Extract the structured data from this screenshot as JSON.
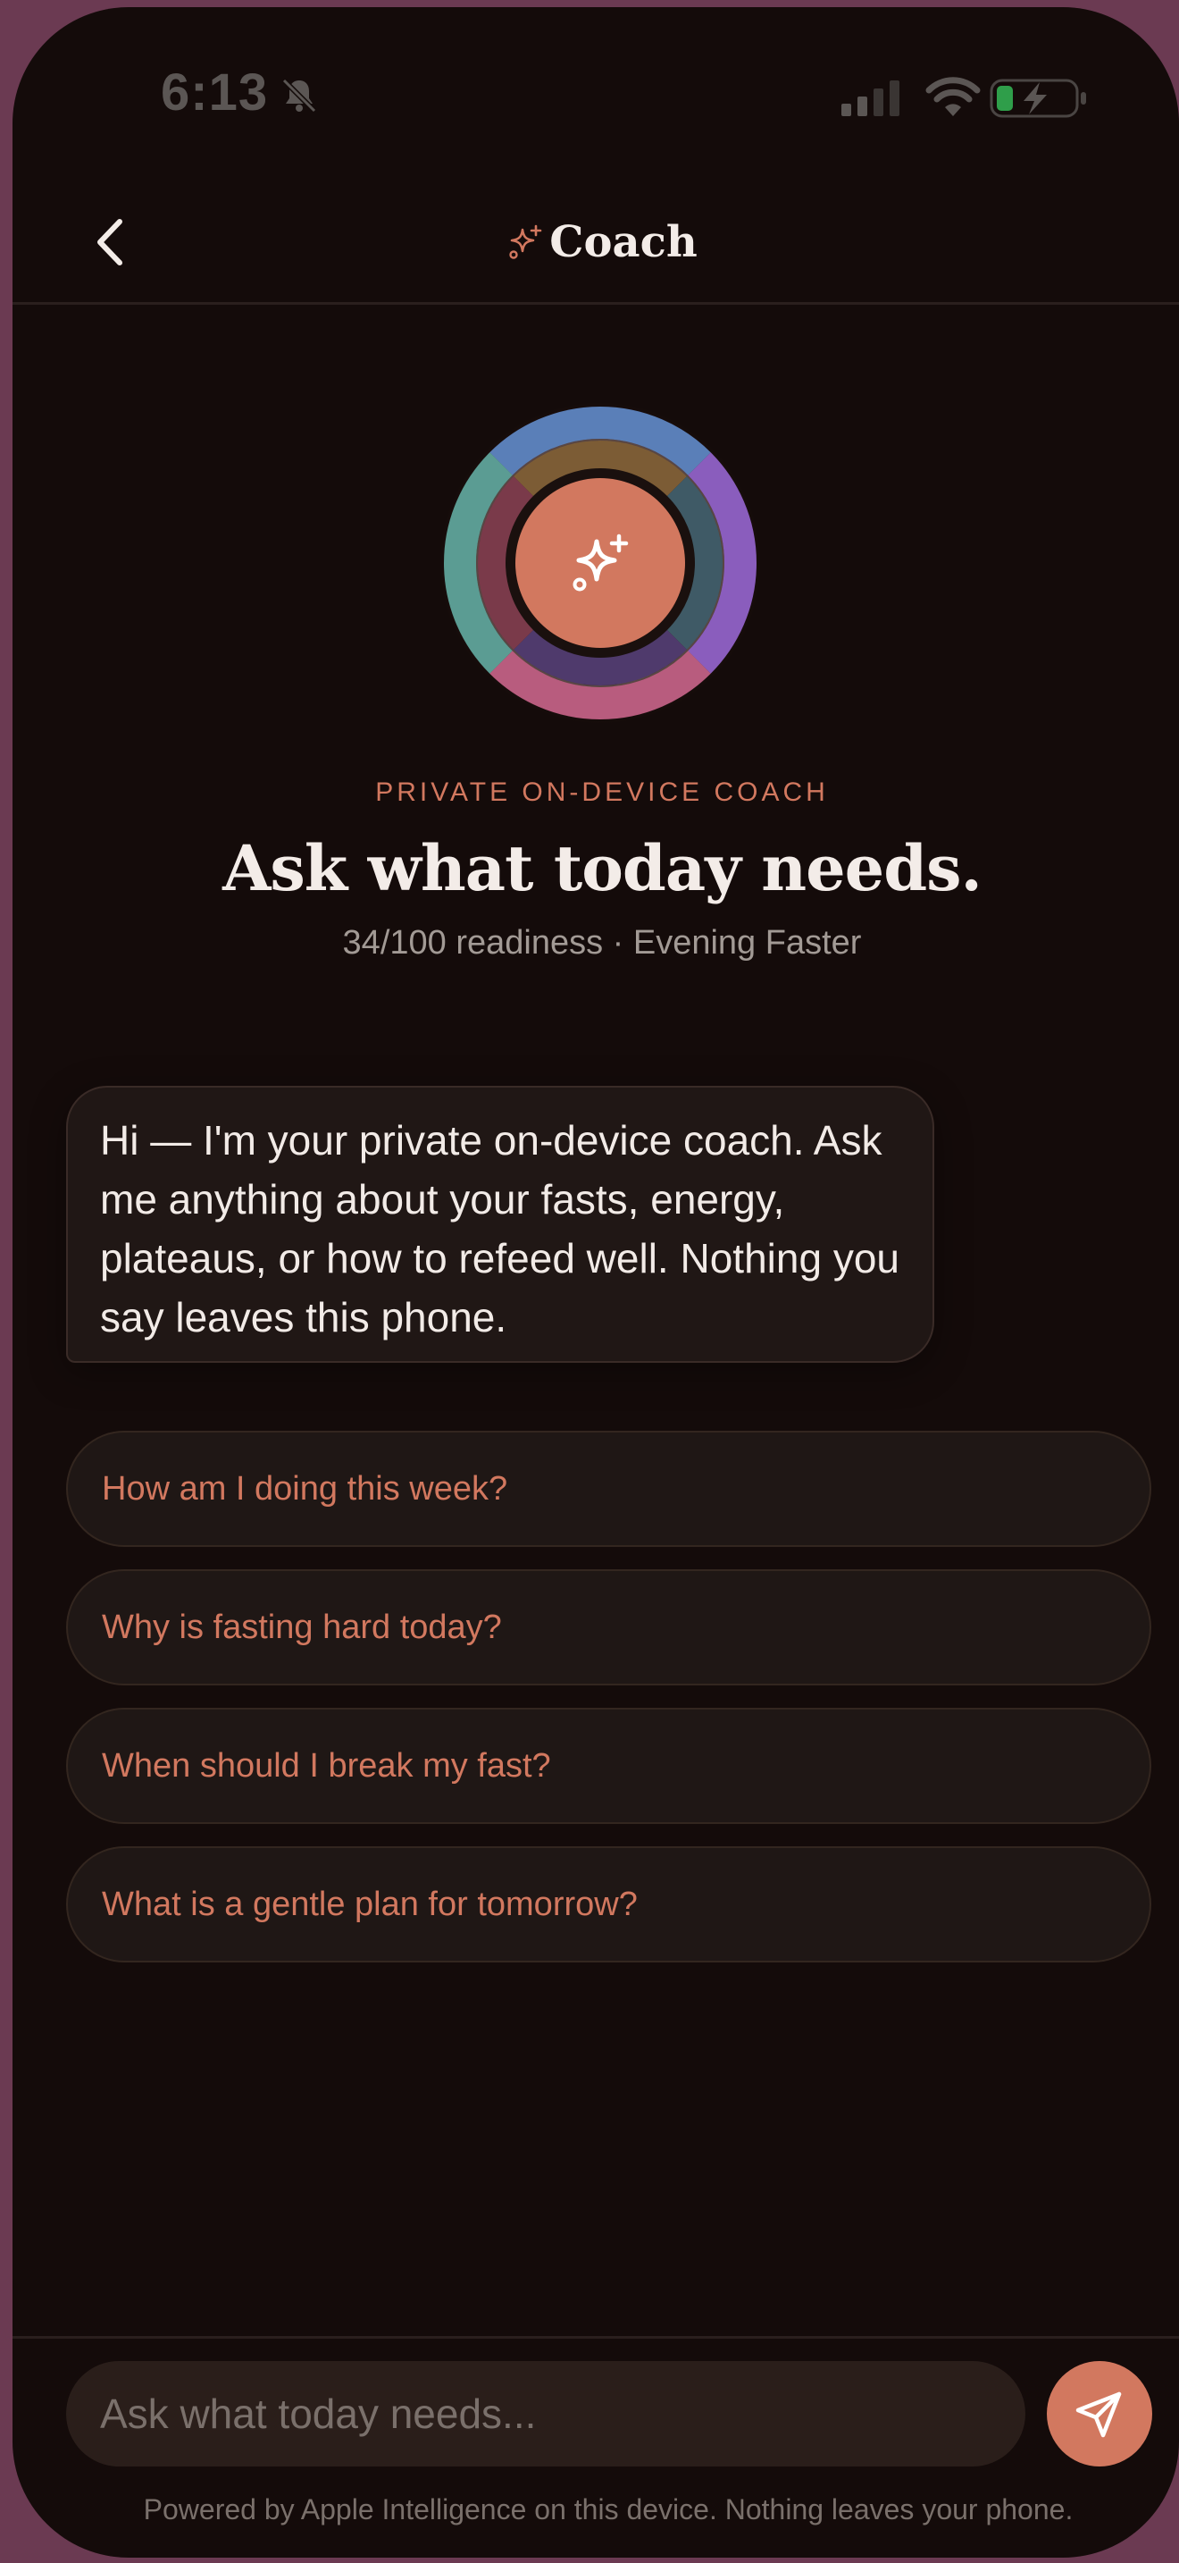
{
  "status_bar": {
    "time": "6:13",
    "icons": [
      "bell-muted-icon",
      "cellular-signal-icon",
      "wifi-icon",
      "battery-charging-icon"
    ]
  },
  "header": {
    "back_icon": "chevron-left-icon",
    "title_icon": "sparkles-icon",
    "title": "Coach"
  },
  "hero": {
    "center_icon": "sparkles-icon",
    "kicker": "PRIVATE ON-DEVICE COACH",
    "title": "Ask what today needs.",
    "subtitle": "34/100 readiness · Evening Faster",
    "ring_colors": [
      "#5a7fb8",
      "#8a5dbd",
      "#b85c7e",
      "#5b9c93"
    ]
  },
  "chat": {
    "messages": [
      {
        "role": "assistant",
        "text": "Hi — I'm your private on-device coach. Ask me anything about your fasts, energy, plateaus, or how to refeed well. Nothing you say leaves this phone."
      }
    ]
  },
  "suggestions": [
    "How am I doing this week?",
    "Why is fasting hard today?",
    "When should I break my fast?",
    "What is a gentle plan for tomorrow?"
  ],
  "composer": {
    "placeholder": "Ask what today needs...",
    "value": "",
    "send_icon": "paper-plane-icon",
    "footnote": "Powered by Apple Intelligence on this device. Nothing leaves your phone."
  },
  "colors": {
    "background": "#140b0a",
    "accent": "#d2785f",
    "text_primary": "#f3ece8",
    "text_secondary": "#a29a95"
  }
}
